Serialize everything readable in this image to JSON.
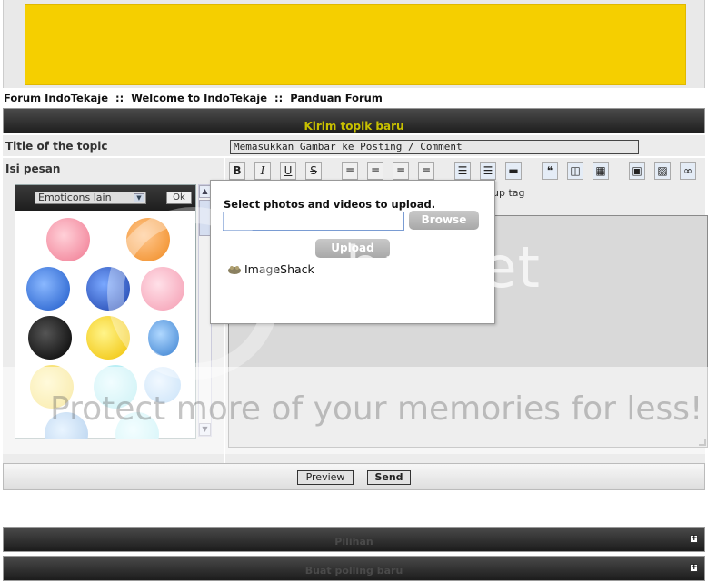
{
  "breadcrumb": {
    "items": [
      "Forum IndoTekaje",
      "::",
      "Welcome to IndoTekaje",
      "::",
      "Panduan Forum"
    ]
  },
  "post_header": {
    "title": "Kirim topik baru"
  },
  "form": {
    "topic_label": "Title of the topic",
    "topic_value": "Memasukkan Gambar ke Posting / Comment",
    "message_label": "Isi pesan"
  },
  "emoticons": {
    "select_value": "Emoticons lain",
    "ok_label": "Ok"
  },
  "toolbar": {
    "bold": "B",
    "italic": "I",
    "underline": "U",
    "strike": "S",
    "uptag_label": "up tag"
  },
  "popup": {
    "message": "Select photos and videos to upload.",
    "browse_label": "Browse",
    "upload_label": "Upload",
    "brand": "ImageShack"
  },
  "actions": {
    "preview_label": "Preview",
    "send_label": "Send"
  },
  "sections": [
    {
      "title": "Pilihan",
      "toggle": "+"
    },
    {
      "title": "Buat polling baru",
      "toggle": "+"
    }
  ],
  "watermark": {
    "line1": "bucket",
    "line2": "Protect more of your memories for less!"
  },
  "colors": {
    "banner": "#f5cf00",
    "header_text": "#c8c000",
    "dark_bar": "#2a2a2a"
  }
}
